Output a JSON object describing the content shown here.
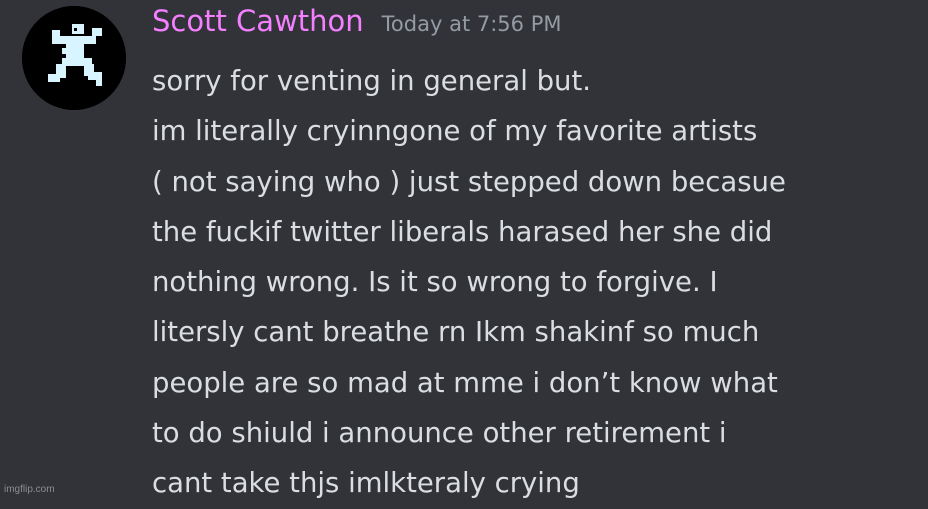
{
  "message": {
    "author": "Scott Cawthon",
    "timestamp": "Today at 7:56 PM",
    "avatar_icon": "pixel-figure-icon",
    "lines": [
      "sorry for venting in general but.",
      "im literally cryinngone of my favorite artists",
      "( not saying who ) just stepped down becasue",
      "the fuckif twitter liberals harased her she did",
      "nothing wrong. Is it so wrong to forgive. I",
      "litersly cant breathe rn Ikm shakinf so much",
      "people are so mad at mme i don’t know what",
      "to do shiuld i announce other retirement i",
      "cant take thjs imlkteraly crying"
    ]
  },
  "colors": {
    "background": "#313338",
    "username": "#f47fff",
    "timestamp": "#949ba4",
    "text": "#dbdee1",
    "avatar_bg": "#000000",
    "avatar_figure": "#d8f4ff"
  },
  "watermark": {
    "text": "imgflip.com"
  }
}
